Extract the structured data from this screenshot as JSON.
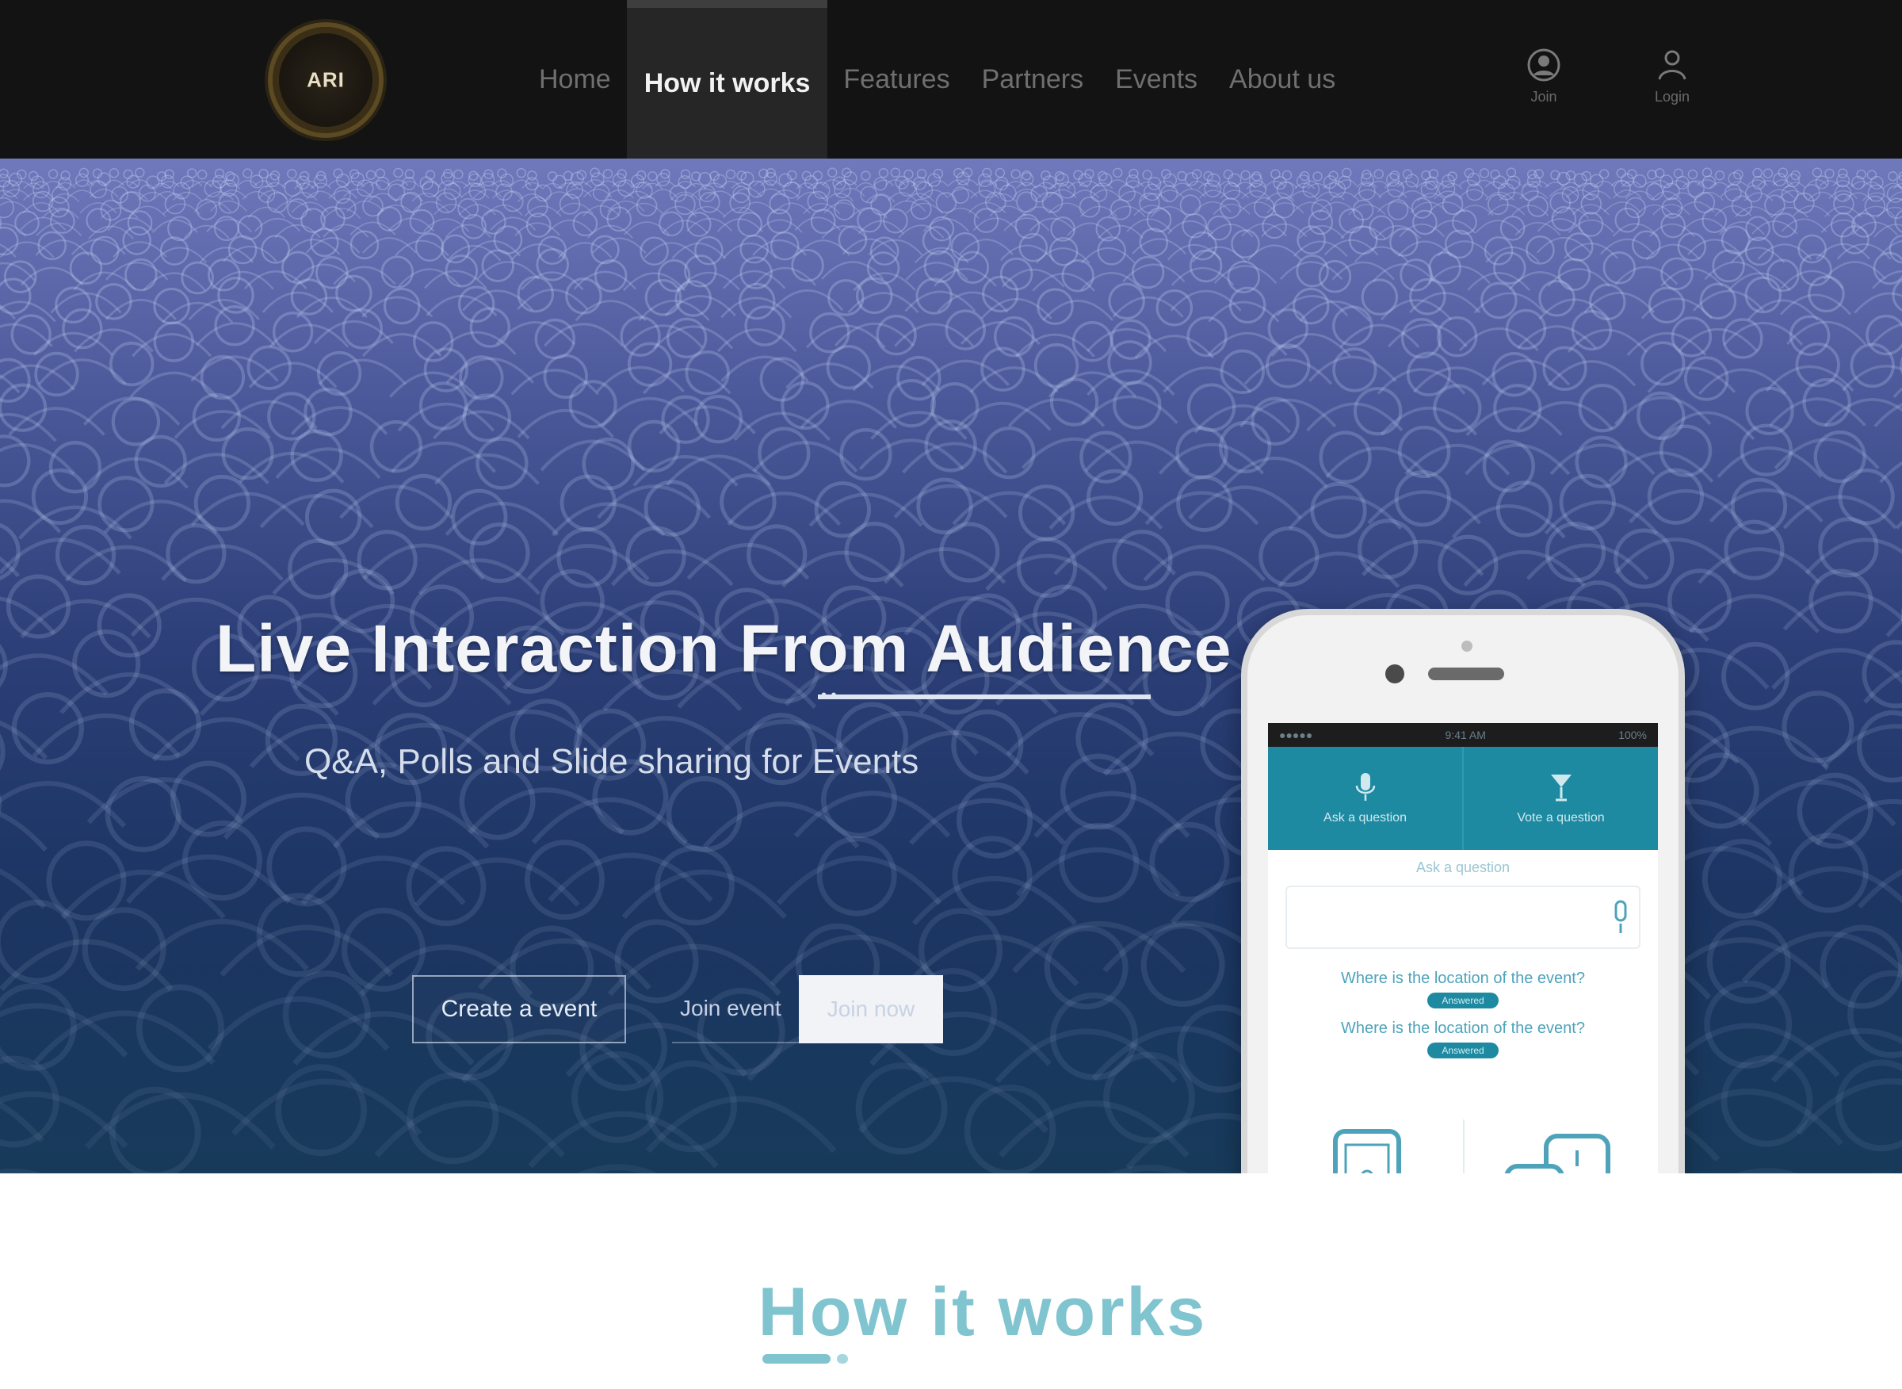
{
  "navbar": {
    "logo_text": "ARI",
    "menu": [
      {
        "label": "Home",
        "active": false
      },
      {
        "label": "How it works",
        "active": true
      },
      {
        "label": "Features",
        "active": false
      },
      {
        "label": "Partners",
        "active": false
      },
      {
        "label": "Events",
        "active": false
      },
      {
        "label": "About us",
        "active": false
      }
    ],
    "icons": [
      {
        "icon": "user-circle-icon",
        "label": "Join"
      },
      {
        "icon": "person-icon",
        "label": "Login"
      }
    ]
  },
  "hero": {
    "title": "Live Interaction From Audience",
    "subtitle": "Q&A, Polls and Slide sharing for Events",
    "create_button": "Create a event",
    "join_placeholder": "Join event",
    "join_button": "Join now"
  },
  "phone": {
    "status_left": "●●●●● ",
    "status_center": "9:41 AM",
    "status_right": "100%",
    "tabs": [
      {
        "icon": "microphone-icon",
        "label": "Ask a question"
      },
      {
        "icon": "cocktail-icon",
        "label": "Vote a question"
      }
    ],
    "prompt": "Ask a question",
    "questions": [
      {
        "text": "Where is the location of the event?",
        "badge": "Answered"
      },
      {
        "text": "Where is the location of the event?",
        "badge": "Answered"
      }
    ]
  },
  "how": {
    "title": "How it works"
  },
  "colors": {
    "nav_bg": "#131313",
    "accent_teal": "#1d8aa1",
    "heading_teal": "#7fc4cf"
  }
}
